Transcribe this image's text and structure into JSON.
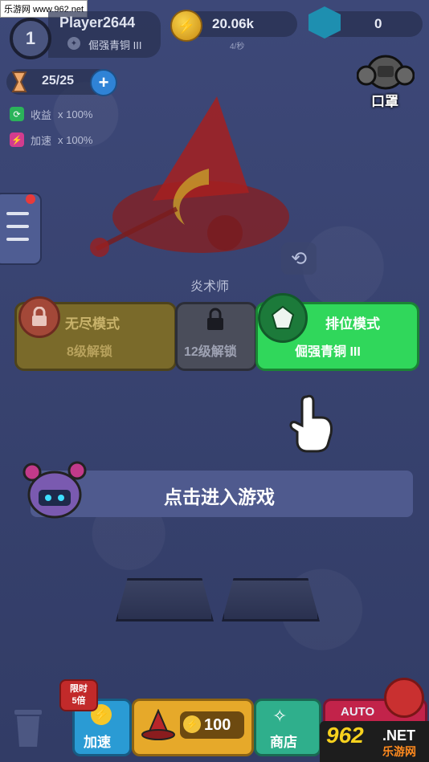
{
  "watermark": "乐游网 www.962.net",
  "player": {
    "level": "1",
    "name": "Player2644",
    "rank": "倔强青铜 III"
  },
  "currency": {
    "coins": "20.06k",
    "coins_rate": "4/秒",
    "gems": "0"
  },
  "energy": {
    "value": "25/25",
    "add": "+"
  },
  "boosts": [
    {
      "label": "收益",
      "value": "x 100%",
      "color": "#2bb35a"
    },
    {
      "label": "加速",
      "value": "x 100%",
      "color": "#d23c8e"
    }
  ],
  "mask": {
    "label": "口罩"
  },
  "hero": {
    "name": "炎术师"
  },
  "modes": {
    "endless": {
      "title": "无尽模式",
      "sub": "8级解锁"
    },
    "level12": {
      "sub": "12级解锁"
    },
    "ranked": {
      "title": "排位模式",
      "sub": "倔强青铜 III"
    }
  },
  "enter": {
    "label": "点击进入游戏"
  },
  "bottom": {
    "limit_badge_line1": "限时",
    "limit_badge_line2": "5倍",
    "speed_label": "加速",
    "summon_cost": "100",
    "shop_label": "商店",
    "auto_label": "AUTO"
  },
  "logo": {
    "big": "962",
    "net": ".NET",
    "cn": "乐游网"
  }
}
